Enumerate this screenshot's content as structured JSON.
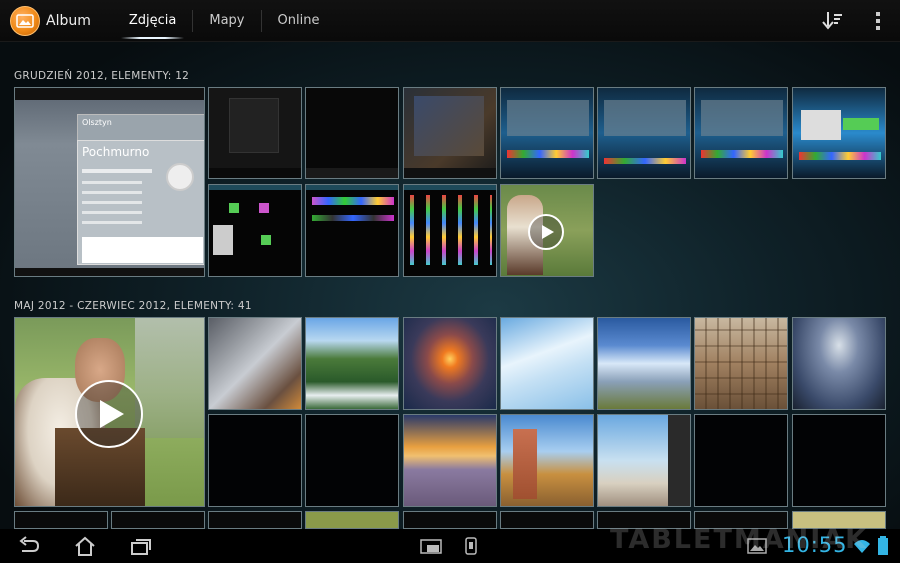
{
  "header": {
    "app_title": "Album",
    "app_icon": "gallery-icon",
    "tabs": [
      {
        "label": "Zdjęcia",
        "active": true
      },
      {
        "label": "Mapy",
        "active": false
      },
      {
        "label": "Online",
        "active": false
      }
    ],
    "sort_icon": "sort-icon",
    "overflow_icon": "overflow-menu-icon"
  },
  "sections": [
    {
      "title": "GRUDZIEŃ 2012, ELEMENTY: 12",
      "featured_thumb": {
        "weather_title": "Pochmurno",
        "weather_city": "Olsztyn"
      }
    },
    {
      "title": "MAJ 2012 - CZERWIEC 2012, ELEMENTY: 41"
    }
  ],
  "system_bar": {
    "clock": "10:55",
    "nav_icons": [
      "back-icon",
      "home-icon",
      "recent-apps-icon"
    ],
    "status_icons": [
      "screenshot-icon",
      "usb-icon",
      "gallery-notification-icon",
      "wifi-icon",
      "battery-icon"
    ],
    "accent_color": "#33b5e5"
  },
  "watermark": "TABLETMANIAK"
}
